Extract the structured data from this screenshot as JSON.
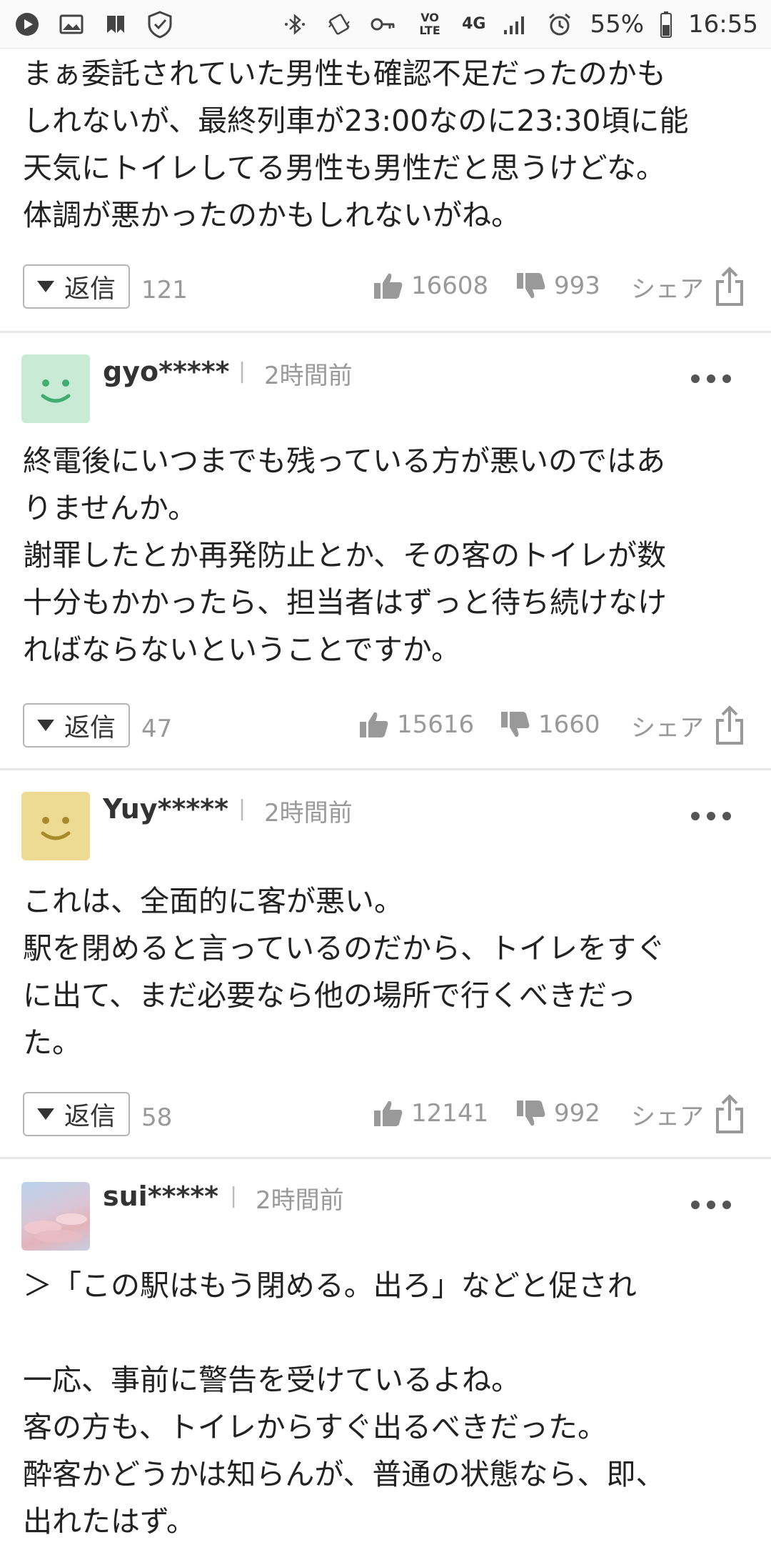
{
  "status_bar": {
    "network": "4G",
    "volte": "VO LTE",
    "battery": "55%",
    "time": "16:55"
  },
  "comments": [
    {
      "body": "まぁ委託されていた男性も確認不足だったのかも\nしれないが、最終列車が23:00なのに23:30頃に能\n天気にトイレしてる男性も男性だと思うけどな。\n体調が悪かったのかもしれないがね。",
      "reply_label": "返信",
      "reply_count": "121",
      "likes": "16608",
      "dislikes": "993",
      "share_label": "シェア"
    },
    {
      "user": "gyo*****",
      "time": "2時間前",
      "body": "終電後にいつまでも残っている方が悪いのではあ\nりませんか。\n謝罪したとか再発防止とか、その客のトイレが数\n十分もかかったら、担当者はずっと待ち続けなけ\nればならないということですか。",
      "reply_label": "返信",
      "reply_count": "47",
      "likes": "15616",
      "dislikes": "1660",
      "share_label": "シェア"
    },
    {
      "user": "Yuy*****",
      "time": "2時間前",
      "body": "これは、全面的に客が悪い。\n駅を閉めると言っているのだから、トイレをすぐ\nに出て、まだ必要なら他の場所で行くべきだっ\nた。",
      "reply_label": "返信",
      "reply_count": "58",
      "likes": "12141",
      "dislikes": "992",
      "share_label": "シェア"
    },
    {
      "user": "sui*****",
      "time": "2時間前",
      "body": "＞「この駅はもう閉める。出ろ」などと促され\n\n一応、事前に警告を受けているよね。\n客の方も、トイレからすぐ出るべきだった。\n酔客かどうかは知らんが、普通の状態なら、即、\n出れたはず。"
    }
  ],
  "colors": {
    "avatar_green": "#c9ead4",
    "avatar_yellow": "#eedb93",
    "icon_gray": "#999999"
  }
}
